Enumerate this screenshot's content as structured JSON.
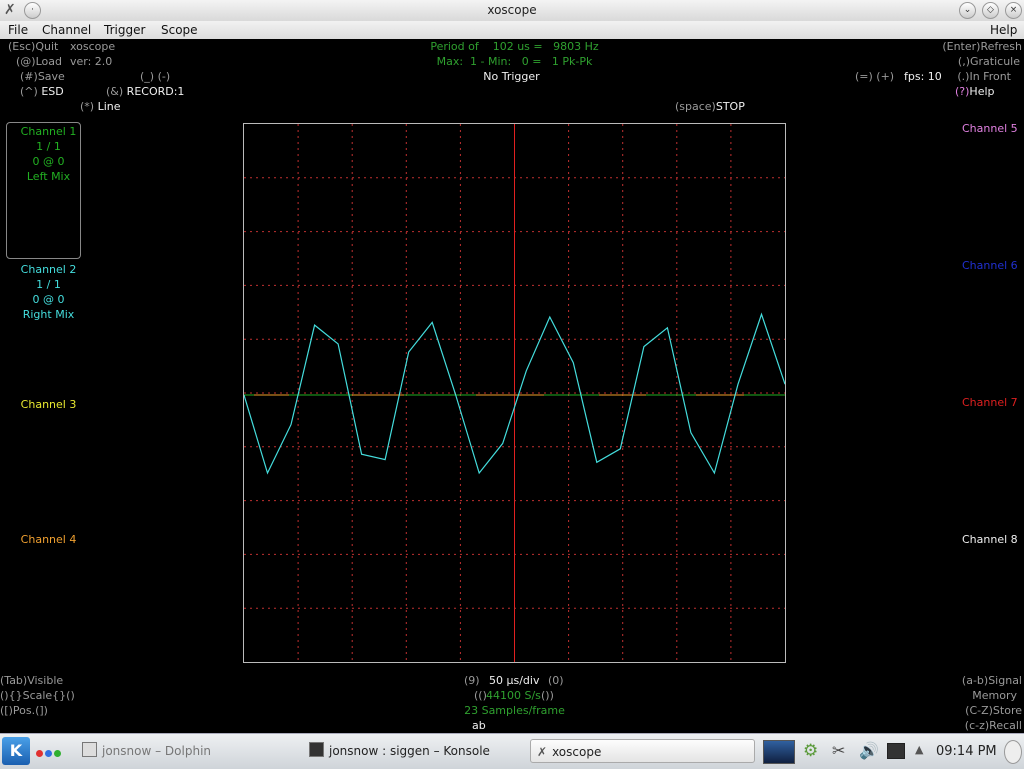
{
  "window": {
    "title": "xoscope"
  },
  "menubar": {
    "items": [
      "File",
      "Channel",
      "Trigger",
      "Scope"
    ],
    "help": "Help"
  },
  "top_left": {
    "quit_key": "(Esc)",
    "quit": "Quit",
    "app_name": "xoscope",
    "load_key": "(@)",
    "load": "Load",
    "version": "ver: 2.0",
    "save_key": "(#)",
    "save": "Save",
    "underscore_keys": "(_) (-)",
    "esd_key": "(^)",
    "esd": "ESD",
    "record_key": "(&)",
    "record": "RECORD:1",
    "line_key": "(*)",
    "line": "Line"
  },
  "top_center": {
    "period": "Period of    102 us =   9803 Hz",
    "maxmin": "Max:  1 - Min:   0 =   1 Pk-Pk",
    "trigger": "No Trigger"
  },
  "top_right": {
    "refresh_key": "(Enter)",
    "refresh": "Refresh",
    "graticule_key": "(,)",
    "graticule": "Graticule",
    "front_key": "(.)",
    "front": "In Front",
    "fps_keys": "(=) (+)",
    "fps": "fps: 10",
    "help_key": "(?)",
    "help": "Help",
    "stop_key": "(space)",
    "stop": "STOP"
  },
  "channels_left": {
    "ch1": {
      "name": "Channel 1",
      "scale": "1 / 1",
      "pos": "0 @ 0",
      "source": "Left Mix"
    },
    "ch2": {
      "name": "Channel 2",
      "scale": "1 / 1",
      "pos": "0 @ 0",
      "source": "Right Mix"
    },
    "ch3": {
      "name": "Channel 3"
    },
    "ch4": {
      "name": "Channel 4"
    }
  },
  "channels_right": {
    "ch5": "Channel 5",
    "ch6": "Channel 6",
    "ch7": "Channel 7",
    "ch8": "Channel 8"
  },
  "bottom_left": {
    "visible": "(Tab)Visible",
    "scale": "(){}Scale{}()",
    "pos": "([)Pos.(])"
  },
  "bottom_center": {
    "tb_dec": "(9)",
    "timebase": "50 µs/div",
    "tb_inc": "(0)",
    "sr_dec": "(()",
    "samplerate": "44100 S/s",
    "sr_inc": "())",
    "samples": "23 Samples/frame",
    "ab": "ab"
  },
  "bottom_right": {
    "signal": "(a-b)Signal",
    "memory": "Memory",
    "store": "(C-Z)Store",
    "recall": "(c-z)Recall"
  },
  "taskbar": {
    "task1": "jonsnow – Dolphin",
    "task2": "jonsnow : siggen – Konsole",
    "task3": "xoscope",
    "clock": "09:14 PM"
  },
  "colors": {
    "ch1": "#22b022",
    "ch2": "#44dddd",
    "ch3": "#e8e830",
    "ch4": "#f0a030",
    "ch5": "#e080e0",
    "ch6": "#2030d0",
    "ch7": "#dd2020",
    "ch8": "#f0f0f0",
    "graticule": "#c03030"
  },
  "traces": {
    "ch2_signal": [
      0,
      -1.45,
      -0.55,
      1.3,
      0.95,
      -1.1,
      -1.2,
      0.8,
      1.35,
      0,
      -1.45,
      -0.9,
      0.45,
      1.45,
      0.6,
      -1.25,
      -1.0,
      0.9,
      1.25,
      -0.7,
      -1.45,
      0.2,
      1.5,
      0.2
    ],
    "ch1_level": 0
  }
}
